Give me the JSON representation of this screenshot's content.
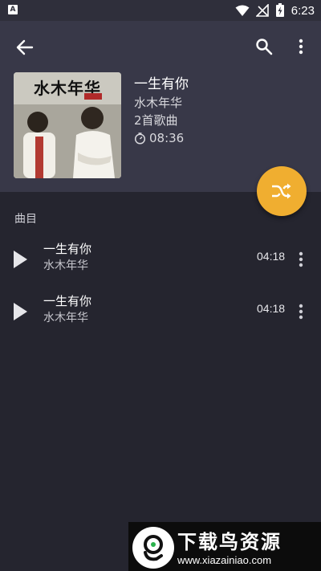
{
  "status_bar": {
    "notification_badge": "A",
    "time": "6:23"
  },
  "toolbar": {
    "back_icon": "arrow-left-icon",
    "search_icon": "search-icon",
    "more_icon": "more-vertical-icon"
  },
  "album": {
    "cover_text": "水木年华",
    "title": "一生有你",
    "artist": "水木年华",
    "song_count": "2首歌曲",
    "duration": "08:36"
  },
  "shuffle_icon": "shuffle-icon",
  "section_title": "曲目",
  "tracks": [
    {
      "title": "一生有你",
      "artist": "水木年华",
      "duration": "04:18"
    },
    {
      "title": "一生有你",
      "artist": "水木年华",
      "duration": "04:18"
    }
  ],
  "watermark": {
    "title": "下载鸟资源",
    "url": "www.xiazainiao.com"
  },
  "colors": {
    "background": "#25252f",
    "header": "#383848",
    "accent": "#f0ae30"
  }
}
